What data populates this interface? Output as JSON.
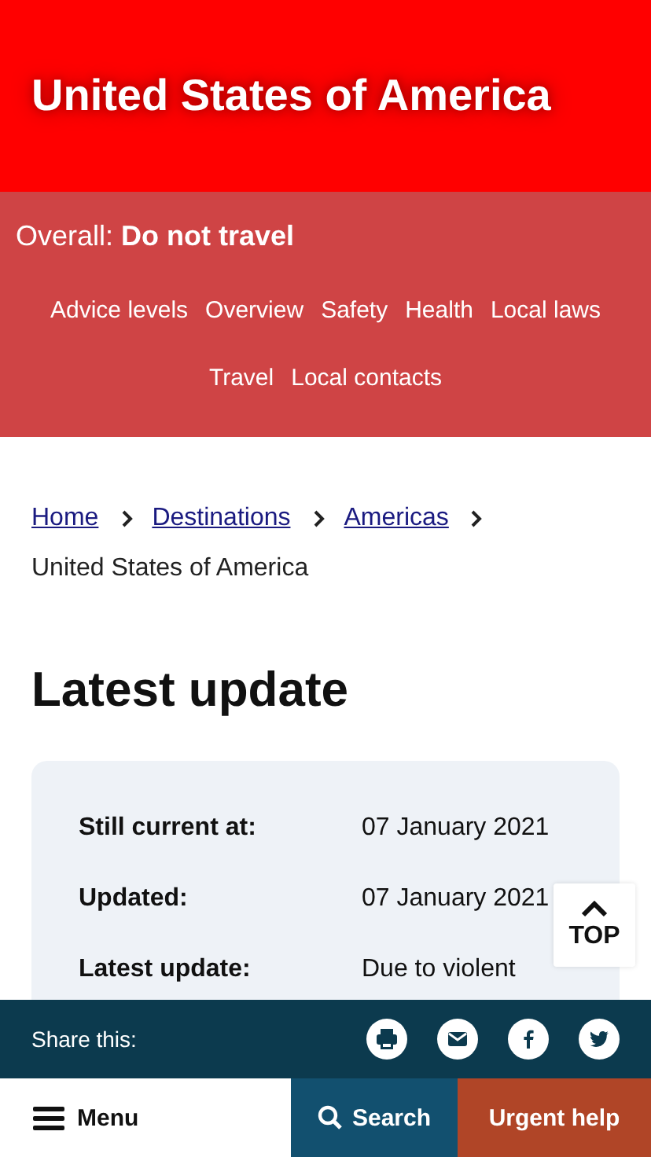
{
  "header": {
    "title": "United States of America"
  },
  "advice": {
    "label": "Overall:",
    "level": "Do not travel"
  },
  "nav": [
    {
      "label": "Advice levels"
    },
    {
      "label": "Overview"
    },
    {
      "label": "Safety"
    },
    {
      "label": "Health"
    },
    {
      "label": "Local laws"
    },
    {
      "label": "Travel"
    },
    {
      "label": "Local contacts"
    }
  ],
  "breadcrumb": [
    {
      "label": "Home",
      "link": true
    },
    {
      "label": "Destinations",
      "link": true
    },
    {
      "label": "Americas",
      "link": true
    },
    {
      "label": "United States of America",
      "link": false
    }
  ],
  "heading": "Latest update",
  "summary": [
    {
      "label": "Still current at:",
      "value": "07 January 2021"
    },
    {
      "label": "Updated:",
      "value": "07 January 2021"
    },
    {
      "label": "Latest update:",
      "value": "Due to violent"
    }
  ],
  "top_button": {
    "label": "TOP"
  },
  "share": {
    "label": "Share this:"
  },
  "bottom_nav": [
    {
      "kind": "menu",
      "label": "Menu"
    },
    {
      "kind": "search",
      "label": "Search"
    },
    {
      "kind": "urgent",
      "label": "Urgent help"
    }
  ]
}
